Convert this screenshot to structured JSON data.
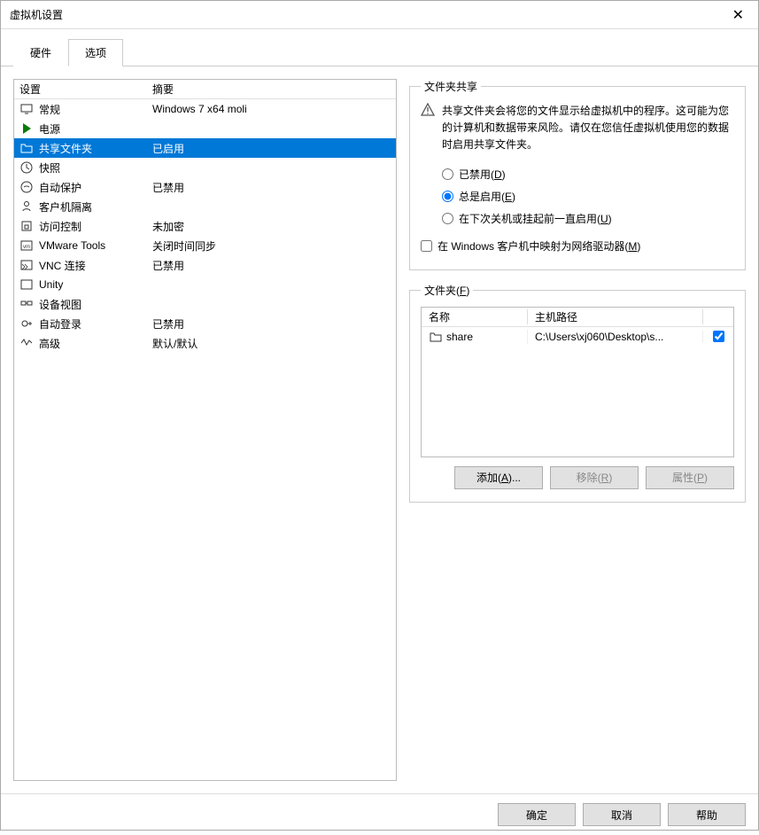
{
  "window": {
    "title": "虚拟机设置"
  },
  "tabs": {
    "hardware": "硬件",
    "options": "选项"
  },
  "list": {
    "header_setting": "设置",
    "header_summary": "摘要",
    "rows": [
      {
        "label": "常规",
        "summary": "Windows 7 x64 moli",
        "icon": "monitor"
      },
      {
        "label": "电源",
        "summary": "",
        "icon": "play"
      },
      {
        "label": "共享文件夹",
        "summary": "已启用",
        "icon": "folder",
        "selected": true
      },
      {
        "label": "快照",
        "summary": "",
        "icon": "clock"
      },
      {
        "label": "自动保护",
        "summary": "已禁用",
        "icon": "shield"
      },
      {
        "label": "客户机隔离",
        "summary": "",
        "icon": "isolate"
      },
      {
        "label": "访问控制",
        "summary": "未加密",
        "icon": "lock"
      },
      {
        "label": "VMware Tools",
        "summary": "关闭时间同步",
        "icon": "vm"
      },
      {
        "label": "VNC 连接",
        "summary": "已禁用",
        "icon": "vnc"
      },
      {
        "label": "Unity",
        "summary": "",
        "icon": "unity"
      },
      {
        "label": "设备视图",
        "summary": "",
        "icon": "device"
      },
      {
        "label": "自动登录",
        "summary": "已禁用",
        "icon": "login"
      },
      {
        "label": "高级",
        "summary": "默认/默认",
        "icon": "advanced"
      }
    ]
  },
  "share": {
    "group_title": "文件夹共享",
    "warning": "共享文件夹会将您的文件显示给虚拟机中的程序。这可能为您的计算机和数据带来风险。请仅在您信任虚拟机使用您的数据时启用共享文件夹。",
    "radio_disabled_pre": "已禁用(",
    "radio_disabled_key": "D",
    "radio_disabled_post": ")",
    "radio_enabled_pre": "总是启用(",
    "radio_enabled_key": "E",
    "radio_enabled_post": ")",
    "radio_until_pre": "在下次关机或挂起前一直启用(",
    "radio_until_key": "U",
    "radio_until_post": ")",
    "check_map_pre": "在 Windows 客户机中映射为网络驱动器(",
    "check_map_key": "M",
    "check_map_post": ")"
  },
  "folders": {
    "group_pre": "文件夹(",
    "group_key": "F",
    "group_post": ")",
    "col_name": "名称",
    "col_path": "主机路径",
    "rows": [
      {
        "name": "share",
        "path": "C:\\Users\\xj060\\Desktop\\s...",
        "checked": true
      }
    ],
    "btn_add_pre": "添加(",
    "btn_add_key": "A",
    "btn_add_post": ")...",
    "btn_remove_pre": "移除(",
    "btn_remove_key": "R",
    "btn_remove_post": ")",
    "btn_props_pre": "属性(",
    "btn_props_key": "P",
    "btn_props_post": ")"
  },
  "footer": {
    "ok": "确定",
    "cancel": "取消",
    "help": "帮助"
  }
}
